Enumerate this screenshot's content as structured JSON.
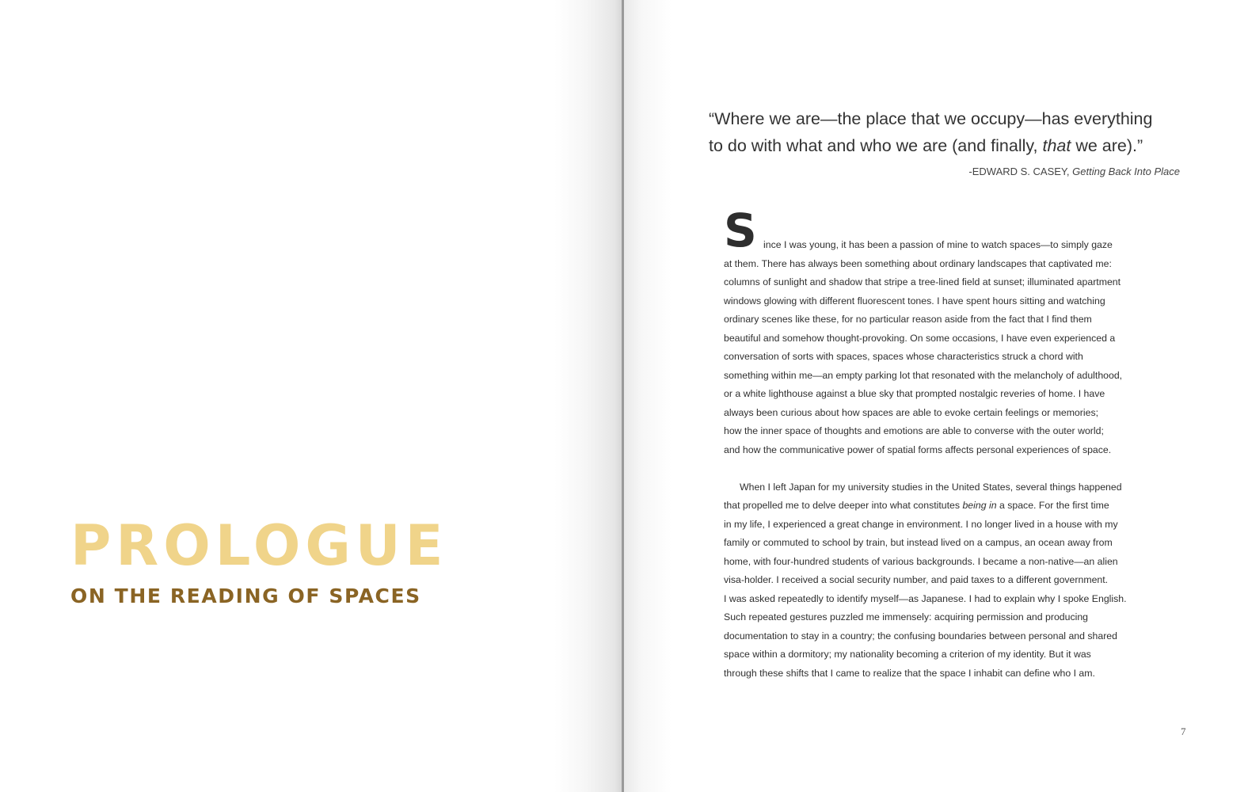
{
  "left_page": {
    "title": "PROLOGUE",
    "subtitle": "ON THE READING OF SPACES"
  },
  "right_page": {
    "epigraph": {
      "line1": "“Where we are—the place that we occupy—has everything",
      "line2_before": "to do with what and who we are (and finally, ",
      "line2_emphasis": "that",
      "line2_after": " we are).”",
      "author": "-EDWARD S. CASEY, ",
      "book": "Getting Back Into Place"
    },
    "dropcap": "S",
    "paragraph1": [
      "ince I was young, it has been a passion of mine to watch spaces—to simply gaze",
      "at them.  There has always been something about ordinary landscapes that captivated me:",
      "columns of sunlight and shadow that stripe a tree-lined field at sunset; illuminated apartment",
      "windows glowing with different fluorescent tones.  I have spent hours sitting and watching",
      "ordinary scenes like these, for no particular reason aside from the fact that I find them",
      "beautiful and somehow thought-provoking.  On some occasions, I have even experienced a",
      "conversation of sorts with spaces, spaces whose characteristics struck a chord with",
      "something within me—an empty parking lot that resonated with the melancholy of adulthood,",
      "or a white lighthouse against a blue sky that prompted nostalgic reveries of home.  I have",
      "always been curious about how spaces are able to evoke certain feelings or memories;",
      "how the inner space of thoughts and emotions are able to converse with the outer world;",
      "and how the communicative power of spatial forms affects personal experiences of space."
    ],
    "paragraph2": {
      "line1": "When I left Japan for my university studies in the United States, several things happened",
      "line2_before": "that propelled me to delve deeper into what constitutes ",
      "line2_emphasis": "being in",
      "line2_after": " a space.  For the first time",
      "rest": [
        "in my life, I experienced a great change in environment.  I no longer lived in a house with my",
        "family or commuted to school by train, but instead lived on a campus, an ocean away from",
        "home, with four-hundred students of various backgrounds.  I became a non-native—an alien",
        "visa-holder.  I received a social security number, and paid taxes to a different government.",
        "I was asked repeatedly to identify myself—as Japanese.  I had to explain why I spoke English.",
        "Such repeated gestures puzzled me immensely: acquiring permission and producing",
        "documentation to stay in a country; the confusing boundaries between personal and shared",
        "space within a dormitory; my nationality becoming a criterion of my identity.  But it was",
        "through these shifts that I came to realize that the space I inhabit can define who I am."
      ]
    },
    "page_number": "7"
  }
}
